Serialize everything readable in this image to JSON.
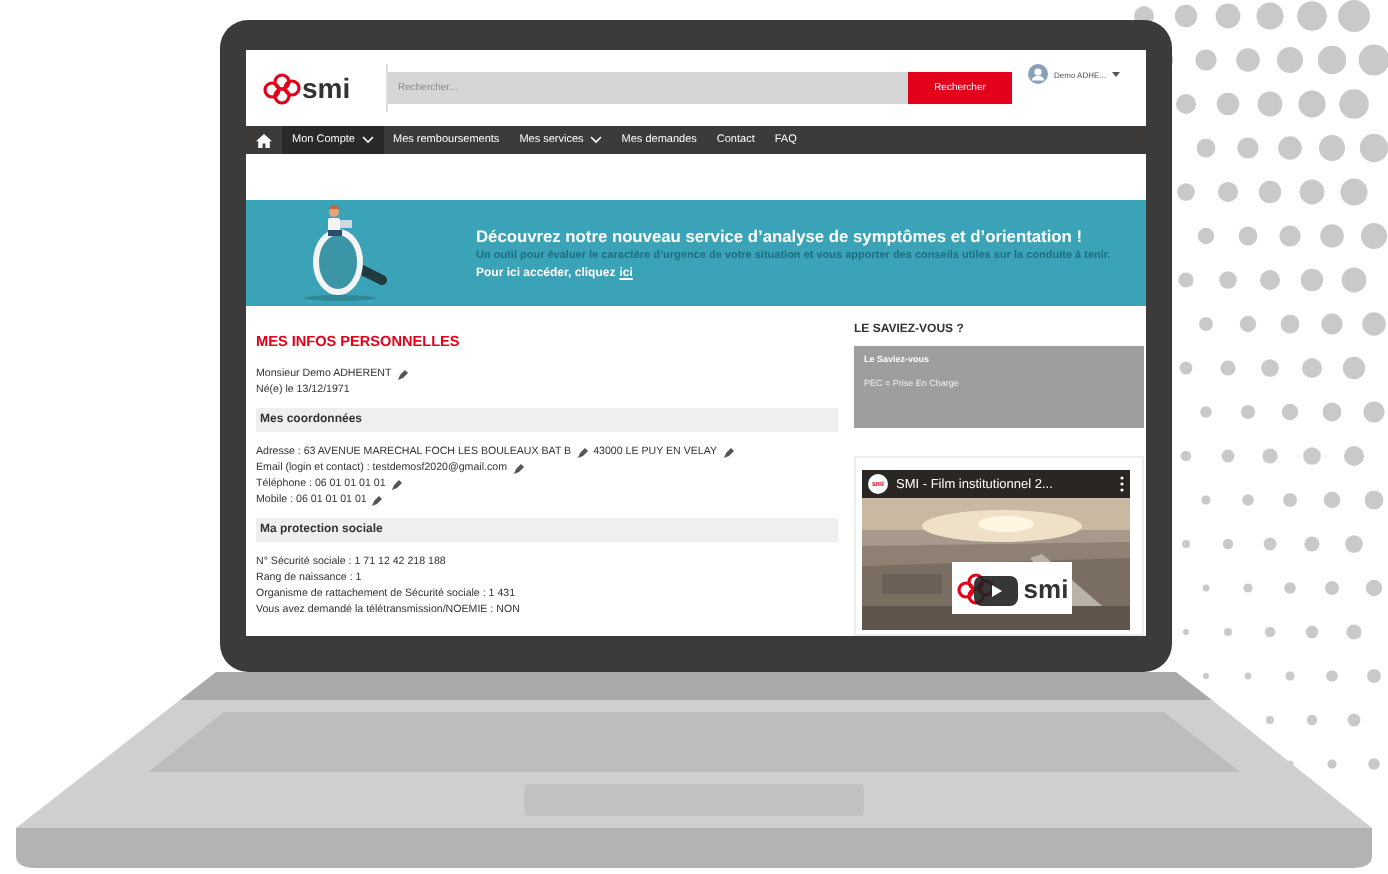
{
  "header": {
    "logo": "smi",
    "search": {
      "placeholder": "Rechercher..."
    },
    "search_button": "Rechercher",
    "user": "Demo ADHE..."
  },
  "nav": [
    {
      "label": "Mon Compte",
      "dropdown": true,
      "selected": true
    },
    {
      "label": "Mes remboursements",
      "dropdown": false,
      "selected": false
    },
    {
      "label": "Mes services",
      "dropdown": true,
      "selected": false
    },
    {
      "label": "Mes demandes",
      "dropdown": false,
      "selected": false
    },
    {
      "label": "Contact",
      "dropdown": false,
      "selected": false
    },
    {
      "label": "FAQ",
      "dropdown": false,
      "selected": false
    }
  ],
  "banner": {
    "title": "Découvrez notre nouveau service d’analyse de symptômes et d’orientation !",
    "text": "Un outil pour évaluer le caractère d’urgence de votre situation et vous apporter des conseils utiles sur la conduite à tenir.",
    "link_prefix": "Pour ici accéder, cliquez",
    "link": "ici"
  },
  "profile": {
    "title": "MES INFOS PERSONNELLES",
    "identity": [
      {
        "parts": [
          {
            "text": "Monsieur Demo ADHERENT",
            "editable": true
          }
        ]
      },
      {
        "parts": [
          {
            "text": "Né(e) le 13/12/1971",
            "editable": false
          }
        ]
      }
    ],
    "sections": [
      {
        "heading": "Mes coordonnées",
        "lines": [
          {
            "parts": [
              {
                "text": "Adresse : 63 AVENUE MARECHAL FOCH LES BOULEAUX BAT B",
                "editable": true
              },
              {
                "text": "43000 LE PUY EN VELAY",
                "editable": true
              }
            ]
          },
          {
            "parts": [
              {
                "text": "Email (login et contact) : testdemosf2020@gmail.com",
                "editable": true
              }
            ]
          },
          {
            "parts": [
              {
                "text": "Téléphone : 06 01 01 01 01",
                "editable": true
              }
            ]
          },
          {
            "parts": [
              {
                "text": "Mobile : 06 01 01 01 01",
                "editable": true
              }
            ]
          }
        ]
      },
      {
        "heading": "Ma protection sociale",
        "lines": [
          {
            "parts": [
              {
                "text": "N° Sécurité sociale : 1 71 12 42 218 188",
                "editable": false
              }
            ]
          },
          {
            "parts": [
              {
                "text": "Rang de naissance : 1",
                "editable": false
              }
            ]
          },
          {
            "parts": [
              {
                "text": "Organisme de rattachement de Sécurité sociale : 1 431",
                "editable": false
              }
            ]
          },
          {
            "parts": [
              {
                "text": "Vous avez demandé la télétransmission/NOEMIE : NON",
                "editable": false
              }
            ]
          }
        ]
      }
    ]
  },
  "sidebar": {
    "title": "LE SAVIEZ-VOUS ?",
    "tip": {
      "title": "Le Saviez-vous",
      "text": "PEC = Prise En Charge"
    },
    "video": {
      "channel_logo": "smi",
      "title": "SMI - Film institutionnel 2...",
      "logo": "smi"
    }
  }
}
